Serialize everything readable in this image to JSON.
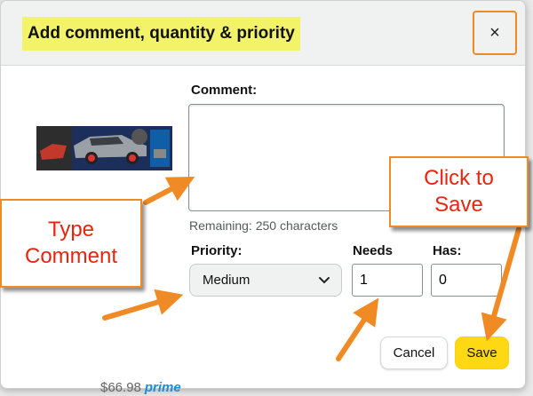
{
  "dialog": {
    "title": "Add comment, quantity & priority",
    "close_label": "×"
  },
  "form": {
    "comment_label": "Comment:",
    "comment_value": "",
    "remaining_text": "Remaining: 250 characters",
    "priority_label": "Priority:",
    "priority_value": "Medium",
    "needs_label": "Needs",
    "needs_value": "1",
    "has_label": "Has:",
    "has_value": "0"
  },
  "buttons": {
    "cancel_label": "Cancel",
    "save_label": "Save"
  },
  "background": {
    "price_text": "$66.98",
    "prime_text": "prime"
  },
  "callouts": {
    "type_comment_line1": "Type",
    "type_comment_line2": "Comment",
    "click_save_line1": "Click to",
    "click_save_line2": "Save"
  },
  "colors": {
    "title_highlight": "#f3f36a",
    "annotation_orange": "#f08a24",
    "annotation_text_red": "#e8240f",
    "save_button_yellow": "#ffd814"
  },
  "icons": {
    "close": "close-icon",
    "select": "chevron-down-icon",
    "product": "toy-car-thumbnail"
  }
}
